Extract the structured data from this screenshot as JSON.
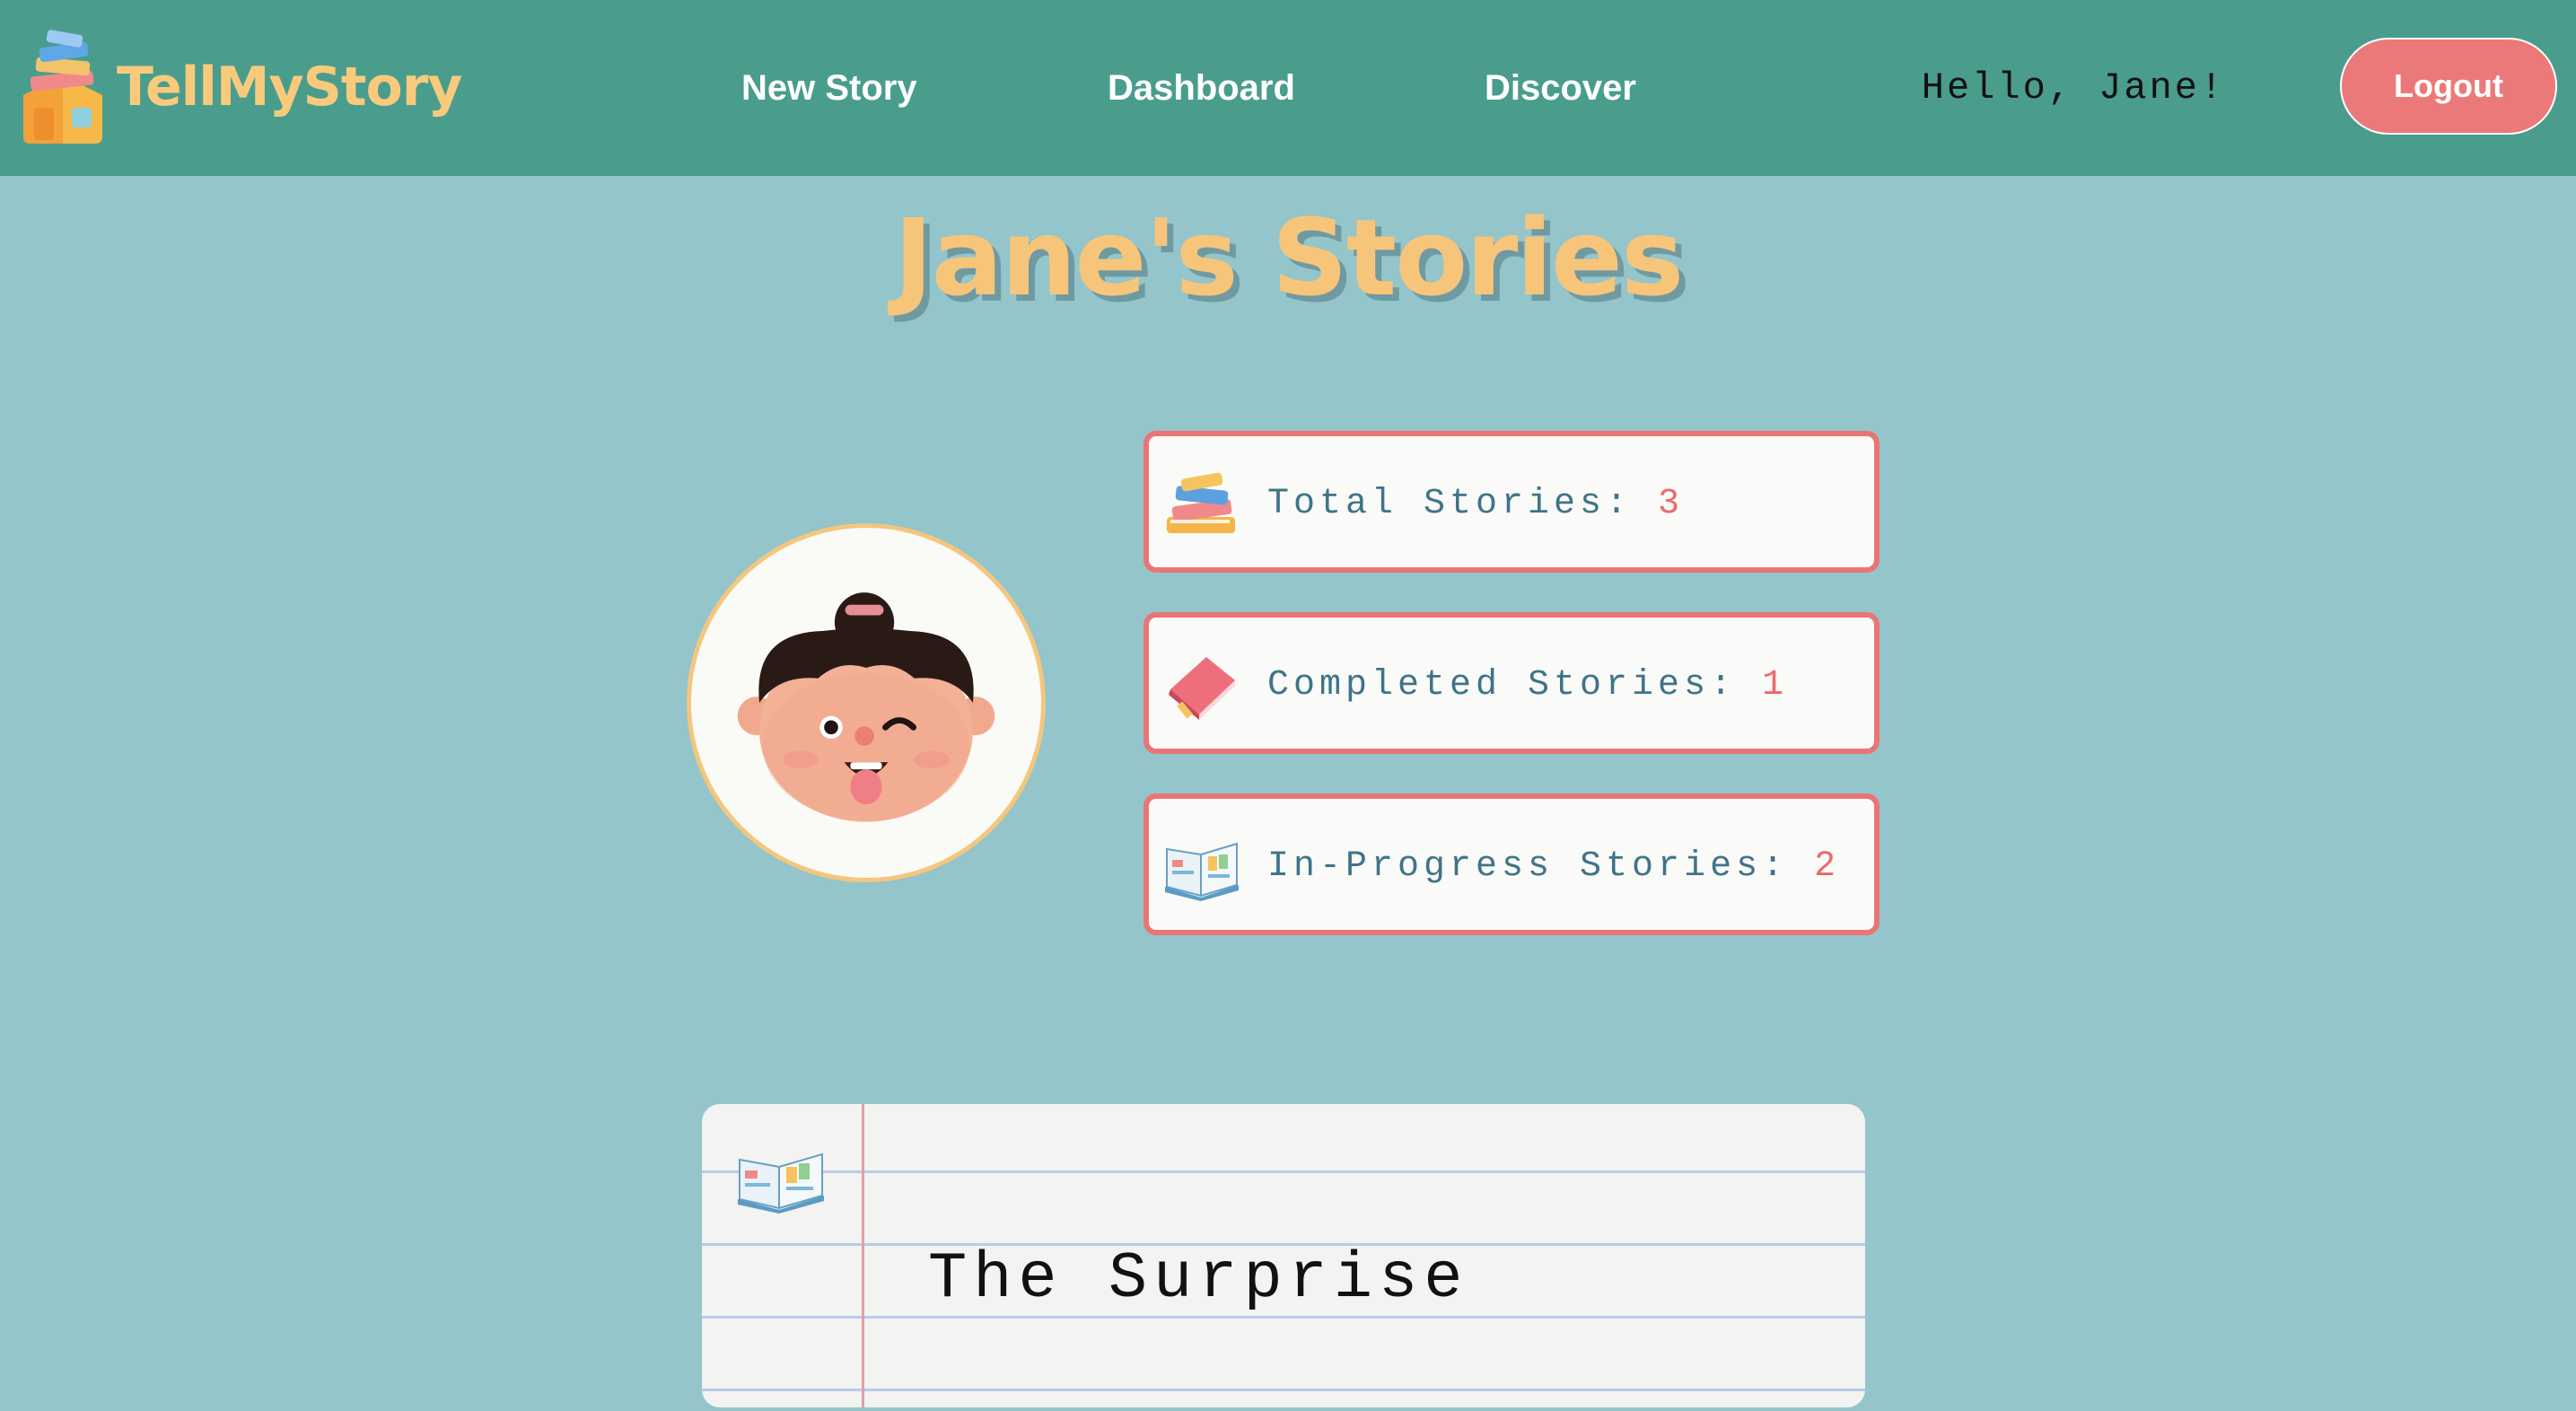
{
  "header": {
    "logo_text": "TellMyStory",
    "nav": [
      "New Story",
      "Dashboard",
      "Discover"
    ],
    "greeting": "Hello, Jane!",
    "logout_label": "Logout"
  },
  "page_title": "Jane's Stories",
  "stats": [
    {
      "label": "Total Stories: ",
      "count": "3",
      "icon": "stack-of-books-icon"
    },
    {
      "label": "Completed Stories: ",
      "count": "1",
      "icon": "closed-book-icon"
    },
    {
      "label": "In-Progress Stories: ",
      "count": "2",
      "icon": "open-book-icon"
    }
  ],
  "stories": [
    {
      "title": "The Surprise",
      "icon": "open-book-icon"
    }
  ],
  "colors": {
    "navbar": "#4a9d8d",
    "background": "#93c5cb",
    "accent_yellow": "#f7c57a",
    "accent_red": "#eb7575",
    "label_blue": "#3f7488"
  }
}
